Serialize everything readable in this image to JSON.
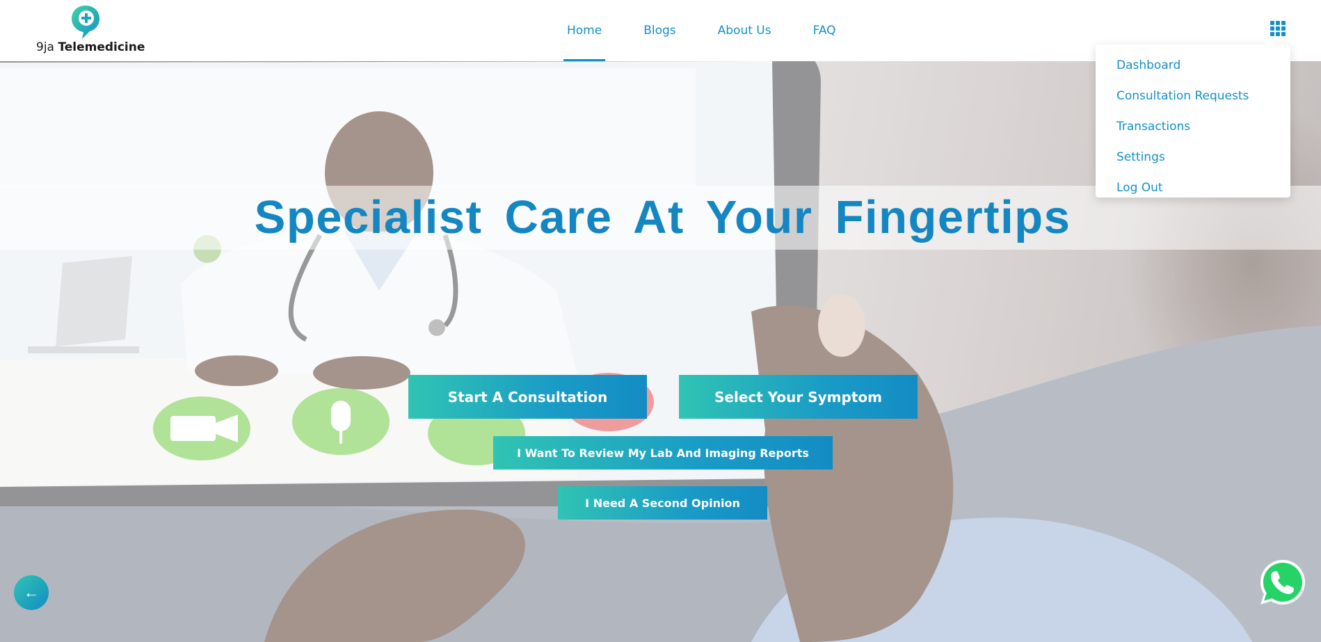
{
  "brand": {
    "prefix": "9ja",
    "name": "Telemedicine"
  },
  "nav": {
    "items": [
      {
        "label": "Home",
        "active": true
      },
      {
        "label": "Blogs",
        "active": false
      },
      {
        "label": "About Us",
        "active": false
      },
      {
        "label": "FAQ",
        "active": false
      }
    ]
  },
  "menu": {
    "icon": "grid-icon",
    "items": [
      {
        "label": "Dashboard"
      },
      {
        "label": "Consultation Requests"
      },
      {
        "label": "Transactions"
      },
      {
        "label": "Settings"
      },
      {
        "label": "Log Out"
      }
    ]
  },
  "hero": {
    "title": "Specialist Care At Your Fingertips",
    "buttons": {
      "start_consultation": "Start A Consultation",
      "select_symptom": "Select Your Symptom",
      "review_reports": "I Want To Review My Lab And Imaging Reports",
      "second_opinion": "I Need A Second Opinion"
    }
  },
  "floating": {
    "back_icon": "arrow-left-icon",
    "back_glyph": "←",
    "whatsapp_icon": "whatsapp-icon"
  },
  "colors": {
    "accent": "#1390c7",
    "title": "#1486c2",
    "gradient_start": "#30c4b3",
    "gradient_end": "#138cc4",
    "whatsapp": "#25d366"
  }
}
